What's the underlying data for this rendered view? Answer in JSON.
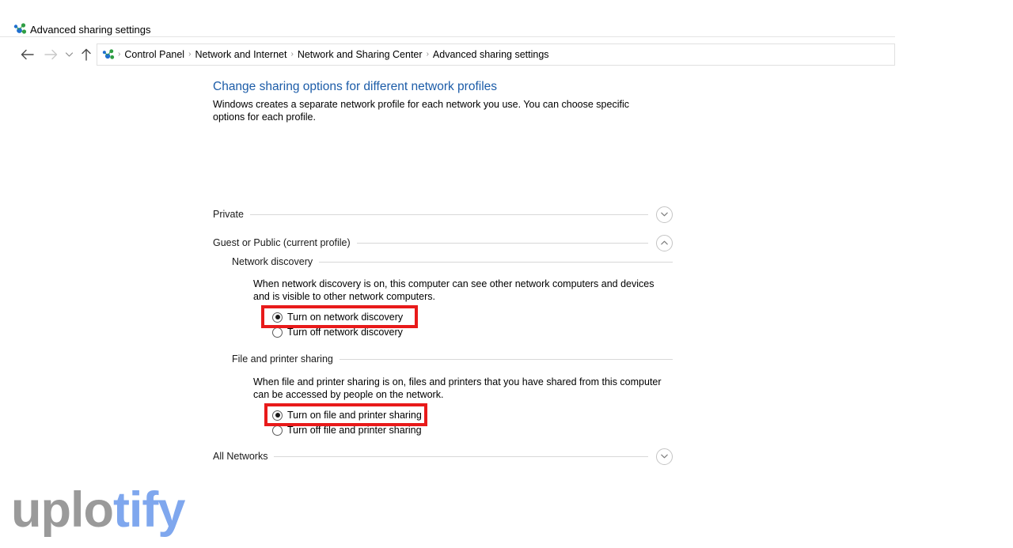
{
  "window": {
    "title": "Advanced sharing settings",
    "icon": "network-sharing-icon"
  },
  "nav": {
    "back": "back-arrow-icon",
    "forward": "forward-arrow-icon",
    "recent": "recent-locations-chevron-icon",
    "up": "up-arrow-icon"
  },
  "breadcrumb": {
    "icon": "network-sharing-icon",
    "separator": "›",
    "items": [
      "Control Panel",
      "Network and Internet",
      "Network and Sharing Center",
      "Advanced sharing settings"
    ]
  },
  "main": {
    "heading": "Change sharing options for different network profiles",
    "description": "Windows creates a separate network profile for each network you use. You can choose specific options for each profile.",
    "profiles": [
      {
        "label": "Private",
        "expanded": false,
        "chevron": "chevron-down-icon"
      },
      {
        "label": "Guest or Public (current profile)",
        "expanded": true,
        "chevron": "chevron-up-icon"
      },
      {
        "label": "All Networks",
        "expanded": false,
        "chevron": "chevron-down-icon"
      }
    ],
    "sections": [
      {
        "title": "Network discovery",
        "description": "When network discovery is on, this computer can see other network computers and devices and is visible to other network computers.",
        "options": [
          {
            "label": "Turn on network discovery",
            "selected": true,
            "highlighted": true
          },
          {
            "label": "Turn off network discovery",
            "selected": false,
            "highlighted": false
          }
        ]
      },
      {
        "title": "File and printer sharing",
        "description": "When file and printer sharing is on, files and printers that you have shared from this computer can be accessed by people on the network.",
        "options": [
          {
            "label": "Turn on file and printer sharing",
            "selected": true,
            "highlighted": true
          },
          {
            "label": "Turn off file and printer sharing",
            "selected": false,
            "highlighted": false
          }
        ]
      }
    ]
  },
  "watermark": {
    "part_a": "uplo",
    "part_b": "tify",
    "color_a": "#9a9a9a",
    "color_b": "#7fa7ee"
  },
  "colors": {
    "heading": "#1c5ca8",
    "highlight": "#e81a1a",
    "rule": "#d8d8d8"
  }
}
